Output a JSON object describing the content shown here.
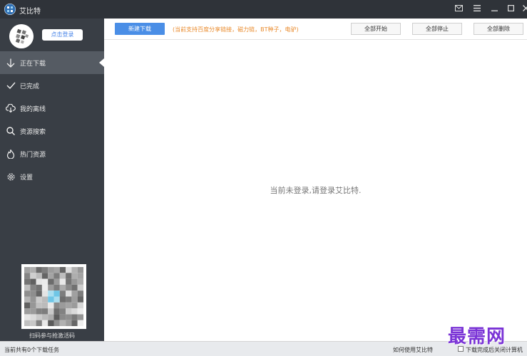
{
  "window": {
    "title": "艾比特",
    "controls": [
      "mail-icon",
      "menu-icon",
      "minimize-icon",
      "maximize-icon",
      "close-icon"
    ]
  },
  "sidebar": {
    "login_label": "点击登录",
    "items": [
      {
        "label": "正在下载",
        "icon": "arrow-down-icon",
        "active": true
      },
      {
        "label": "已完成",
        "icon": "check-icon",
        "active": false
      },
      {
        "label": "我的离线",
        "icon": "cloud-download-icon",
        "active": false
      },
      {
        "label": "资源搜索",
        "icon": "search-icon",
        "active": false
      },
      {
        "label": "热门资源",
        "icon": "flame-icon",
        "active": false
      },
      {
        "label": "设置",
        "icon": "gear-icon",
        "active": false
      }
    ],
    "qr_caption": "扫码参与抢激活码"
  },
  "toolbar": {
    "new_download": "新建下载",
    "hint": "(当前支持百度分享链接，磁力链，BT种子，电驴)",
    "start_all": "全部开始",
    "stop_all": "全部停止",
    "delete_all": "全部删除"
  },
  "main": {
    "empty_message": "当前未登录,请登录艾比特."
  },
  "statusbar": {
    "task_count": "当前共有0个下载任务",
    "help_link": "如何使用艾比特",
    "shutdown_label": "下载完成后关闭计算机"
  },
  "watermark": "最需网",
  "colors": {
    "sidebar_bg": "#393e45",
    "active_item_bg": "#555b63",
    "primary_button": "#4a8ee6",
    "hint_text": "#e98a2b",
    "watermark": "#7a33d6"
  }
}
